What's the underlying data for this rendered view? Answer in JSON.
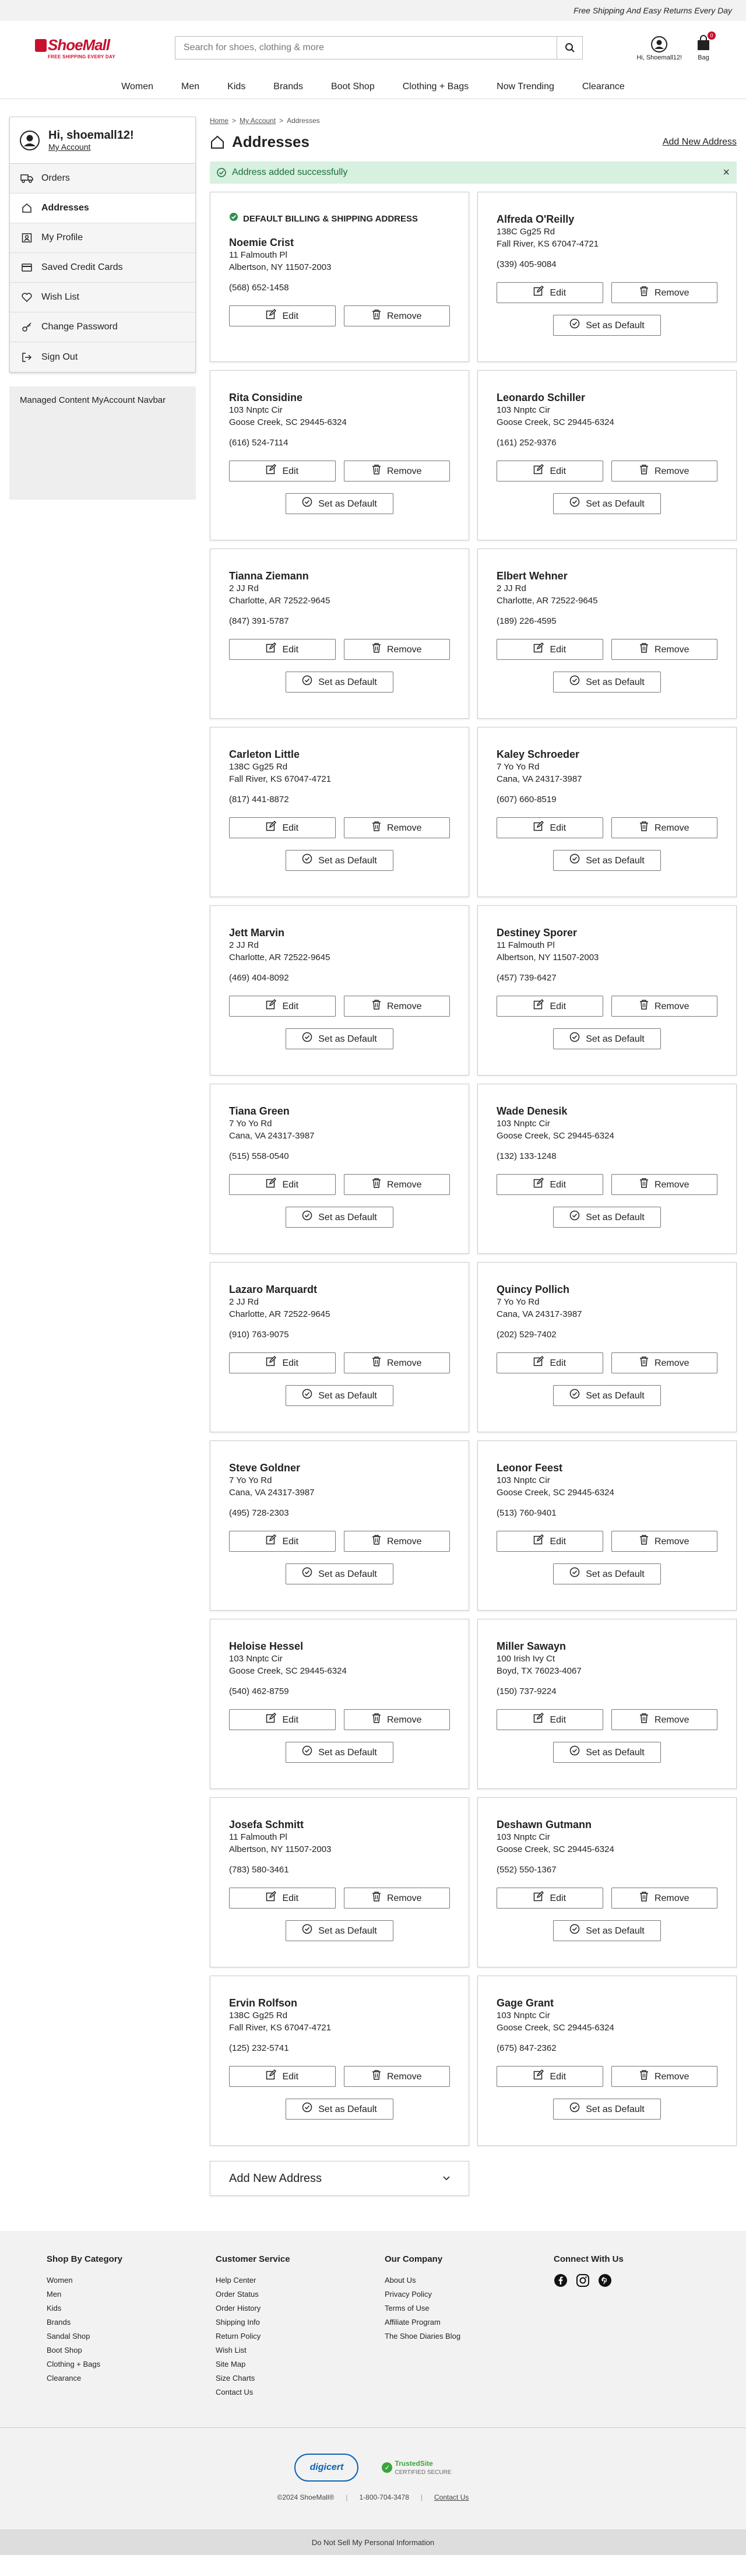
{
  "promo": "Free Shipping And Easy Returns Every Day",
  "logo": {
    "name": "ShoeMall",
    "tagline": "FREE SHIPPING EVERY DAY"
  },
  "search": {
    "placeholder": "Search for shoes, clothing & more"
  },
  "header": {
    "account_label": "Hi, Shoemall12!",
    "bag_label": "Bag",
    "bag_count": "0"
  },
  "nav": [
    "Women",
    "Men",
    "Kids",
    "Brands",
    "Boot Shop",
    "Clothing + Bags",
    "Now Trending",
    "Clearance"
  ],
  "sidebar": {
    "greeting": "Hi, shoemall12!",
    "my_account": "My Account",
    "items": [
      {
        "label": "Orders",
        "icon": "truck-icon"
      },
      {
        "label": "Addresses",
        "icon": "home-icon"
      },
      {
        "label": "My Profile",
        "icon": "profile-icon"
      },
      {
        "label": "Saved Credit Cards",
        "icon": "credit-card-icon"
      },
      {
        "label": "Wish List",
        "icon": "heart-icon"
      },
      {
        "label": "Change Password",
        "icon": "key-icon"
      },
      {
        "label": "Sign Out",
        "icon": "sign-out-icon"
      }
    ],
    "managed": "Managed Content MyAccount Navbar"
  },
  "breadcrumb": [
    "Home",
    "My Account",
    "Addresses"
  ],
  "page": {
    "title": "Addresses",
    "add_link": "Add New Address",
    "alert": "Address added successfully",
    "default_label": "DEFAULT BILLING & SHIPPING ADDRESS",
    "edit": "Edit",
    "remove": "Remove",
    "set_default": "Set as Default",
    "add_new": "Add New Address"
  },
  "addresses": [
    {
      "name": "Noemie Crist",
      "street": "11 Falmouth Pl",
      "city": "Albertson, NY 11507-2003",
      "phone": "(568) 652-1458",
      "default": true
    },
    {
      "name": "Alfreda O'Reilly",
      "street": "138C Gg25 Rd",
      "city": "Fall River, KS 67047-4721",
      "phone": "(339) 405-9084",
      "default": false
    },
    {
      "name": "Rita Considine",
      "street": "103 Nnptc Cir",
      "city": "Goose Creek, SC 29445-6324",
      "phone": "(616) 524-7114",
      "default": false
    },
    {
      "name": "Leonardo Schiller",
      "street": "103 Nnptc Cir",
      "city": "Goose Creek, SC 29445-6324",
      "phone": "(161) 252-9376",
      "default": false
    },
    {
      "name": "Tianna Ziemann",
      "street": "2 JJ Rd",
      "city": "Charlotte, AR 72522-9645",
      "phone": "(847) 391-5787",
      "default": false
    },
    {
      "name": "Elbert Wehner",
      "street": "2 JJ Rd",
      "city": "Charlotte, AR 72522-9645",
      "phone": "(189) 226-4595",
      "default": false
    },
    {
      "name": "Carleton Little",
      "street": "138C Gg25 Rd",
      "city": "Fall River, KS 67047-4721",
      "phone": "(817) 441-8872",
      "default": false
    },
    {
      "name": "Kaley Schroeder",
      "street": "7 Yo Yo Rd",
      "city": "Cana, VA 24317-3987",
      "phone": "(607) 660-8519",
      "default": false
    },
    {
      "name": "Jett Marvin",
      "street": "2 JJ Rd",
      "city": "Charlotte, AR 72522-9645",
      "phone": "(469) 404-8092",
      "default": false
    },
    {
      "name": "Destiney Sporer",
      "street": "11 Falmouth Pl",
      "city": "Albertson, NY 11507-2003",
      "phone": "(457) 739-6427",
      "default": false
    },
    {
      "name": "Tiana Green",
      "street": "7 Yo Yo Rd",
      "city": "Cana, VA 24317-3987",
      "phone": "(515) 558-0540",
      "default": false
    },
    {
      "name": "Wade Denesik",
      "street": "103 Nnptc Cir",
      "city": "Goose Creek, SC 29445-6324",
      "phone": "(132) 133-1248",
      "default": false
    },
    {
      "name": "Lazaro Marquardt",
      "street": "2 JJ Rd",
      "city": "Charlotte, AR 72522-9645",
      "phone": "(910) 763-9075",
      "default": false
    },
    {
      "name": "Quincy Pollich",
      "street": "7 Yo Yo Rd",
      "city": "Cana, VA 24317-3987",
      "phone": "(202) 529-7402",
      "default": false
    },
    {
      "name": "Steve Goldner",
      "street": "7 Yo Yo Rd",
      "city": "Cana, VA 24317-3987",
      "phone": "(495) 728-2303",
      "default": false
    },
    {
      "name": "Leonor Feest",
      "street": "103 Nnptc Cir",
      "city": "Goose Creek, SC 29445-6324",
      "phone": "(513) 760-9401",
      "default": false
    },
    {
      "name": "Heloise Hessel",
      "street": "103 Nnptc Cir",
      "city": "Goose Creek, SC 29445-6324",
      "phone": "(540) 462-8759",
      "default": false
    },
    {
      "name": "Miller Sawayn",
      "street": "100 Irish Ivy Ct",
      "city": "Boyd, TX 76023-4067",
      "phone": "(150) 737-9224",
      "default": false
    },
    {
      "name": "Josefa Schmitt",
      "street": "11 Falmouth Pl",
      "city": "Albertson, NY 11507-2003",
      "phone": "(783) 580-3461",
      "default": false
    },
    {
      "name": "Deshawn Gutmann",
      "street": "103 Nnptc Cir",
      "city": "Goose Creek, SC 29445-6324",
      "phone": "(552) 550-1367",
      "default": false
    },
    {
      "name": "Ervin Rolfson",
      "street": "138C Gg25 Rd",
      "city": "Fall River, KS 67047-4721",
      "phone": "(125) 232-5741",
      "default": false
    },
    {
      "name": "Gage Grant",
      "street": "103 Nnptc Cir",
      "city": "Goose Creek, SC 29445-6324",
      "phone": "(675) 847-2362",
      "default": false
    }
  ],
  "footer": {
    "columns": [
      {
        "title": "Shop By Category",
        "links": [
          "Women",
          "Men",
          "Kids",
          "Brands",
          "Sandal Shop",
          "Boot Shop",
          "Clothing + Bags",
          "Clearance"
        ]
      },
      {
        "title": "Customer Service",
        "links": [
          "Help Center",
          "Order Status",
          "Order History",
          "Shipping Info",
          "Return Policy",
          "Wish List",
          "Site Map",
          "Size Charts",
          "Contact Us"
        ]
      },
      {
        "title": "Our Company",
        "links": [
          "About Us",
          "Privacy Policy",
          "Terms of Use",
          "Affiliate Program",
          "The Shoe Diaries Blog"
        ]
      },
      {
        "title": "Connect With Us",
        "links": []
      }
    ],
    "seal1": "digicert",
    "seal2_name": "TrustedSite",
    "seal2_sub": "CERTIFIED SECURE",
    "copyright": "©2024 ShoeMall®",
    "phone": "1-800-704-3478",
    "contact": "Contact Us",
    "dnsell": "Do Not Sell My Personal Information"
  }
}
